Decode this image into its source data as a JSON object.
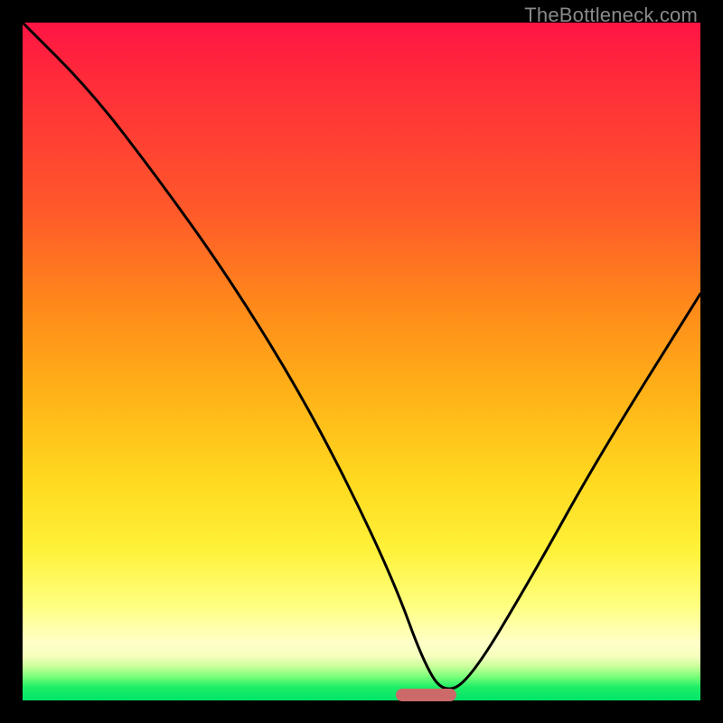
{
  "watermark": "TheBottleneck.com",
  "colors": {
    "frame": "#000000",
    "marker": "#cc6a6a",
    "curve": "#000000"
  },
  "chart_data": {
    "type": "line",
    "title": "",
    "xlabel": "",
    "ylabel": "",
    "xlim": [
      0,
      100
    ],
    "ylim": [
      0,
      100
    ],
    "grid": false,
    "legend": false,
    "series": [
      {
        "name": "bottleneck-curve",
        "x": [
          0,
          10,
          20,
          30,
          40,
          48,
          55,
          59,
          62,
          66,
          75,
          85,
          100
        ],
        "values": [
          100,
          90,
          77,
          63,
          47,
          32,
          17,
          6,
          1,
          3,
          18,
          36,
          60
        ]
      }
    ],
    "marker": {
      "x_start": 55,
      "x_end": 64,
      "y": 0.8
    }
  }
}
